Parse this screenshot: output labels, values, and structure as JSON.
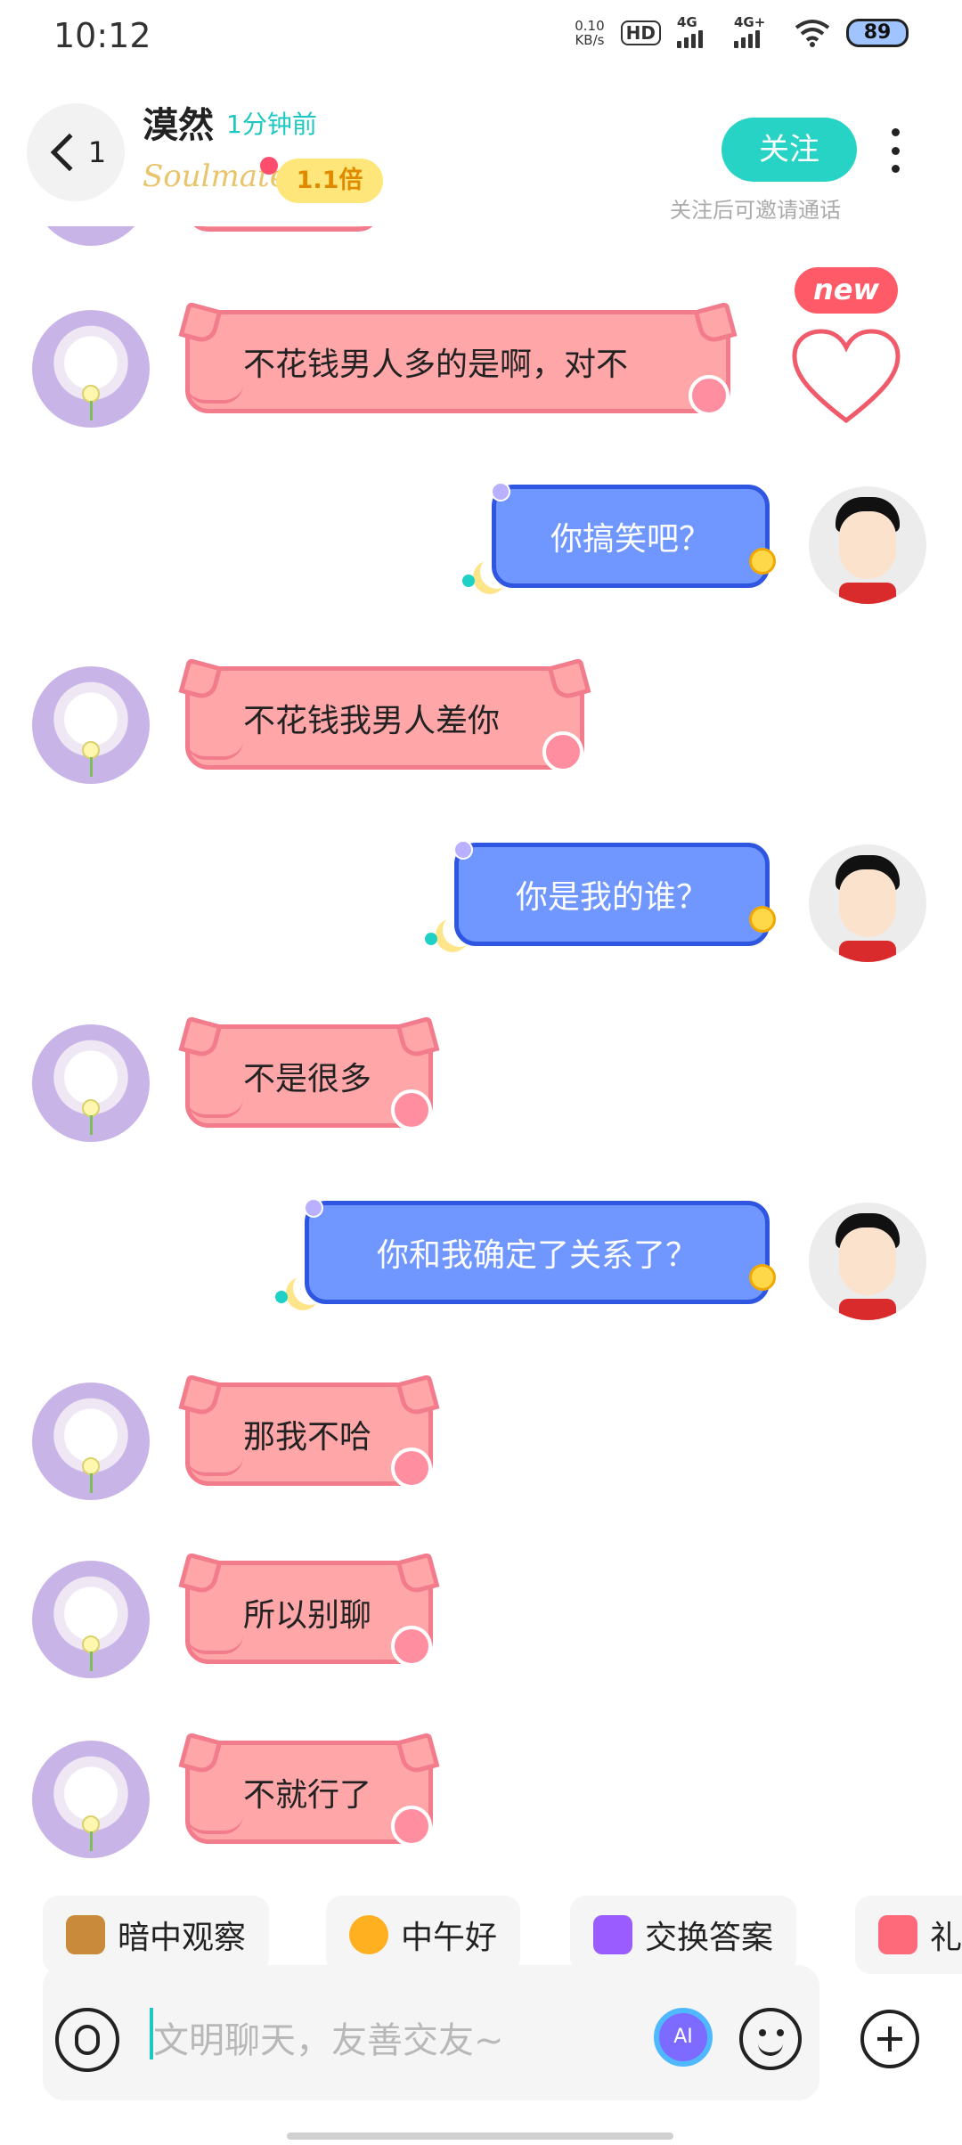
{
  "status_bar": {
    "time": "10:12",
    "net_speed_value": "0.10",
    "net_speed_unit": "KB/s",
    "hd_label": "HD",
    "signal_1_label": "4G",
    "signal_2_label": "4G+",
    "battery": "89"
  },
  "header": {
    "back_count": "1",
    "contact_name": "漠然",
    "last_seen": "1分钟前",
    "soulmate_label": "Soulmate",
    "multiplier": "1.1倍",
    "follow_label": "关注",
    "follow_hint": "关注后可邀请通话"
  },
  "reaction": {
    "new_badge": "new"
  },
  "messages": [
    {
      "from": "her",
      "text": "不花钱男人多的是啊，对不"
    },
    {
      "from": "me",
      "text": "你搞笑吧？"
    },
    {
      "from": "her",
      "text": "不花钱我男人差你"
    },
    {
      "from": "me",
      "text": "你是我的谁？"
    },
    {
      "from": "her",
      "text": "不是很多"
    },
    {
      "from": "me",
      "text": "你和我确定了关系了？"
    },
    {
      "from": "her",
      "text": "那我不哈"
    },
    {
      "from": "her",
      "text": "所以别聊"
    },
    {
      "from": "her",
      "text": "不就行了"
    }
  ],
  "quick_replies": [
    {
      "label": "暗中观察",
      "icon": "dog-peek-icon"
    },
    {
      "label": "中午好",
      "icon": "sun-sunglasses-icon"
    },
    {
      "label": "交换答案",
      "icon": "exchange-icon"
    },
    {
      "label": "礼",
      "icon": "gift-icon"
    }
  ],
  "input": {
    "placeholder": "文明聊天，友善交友~",
    "ai_label": "AI"
  },
  "colors": {
    "accent": "#27d3c5",
    "her_bubble": "#ffa6a9",
    "me_bubble": "#6f97ff"
  }
}
